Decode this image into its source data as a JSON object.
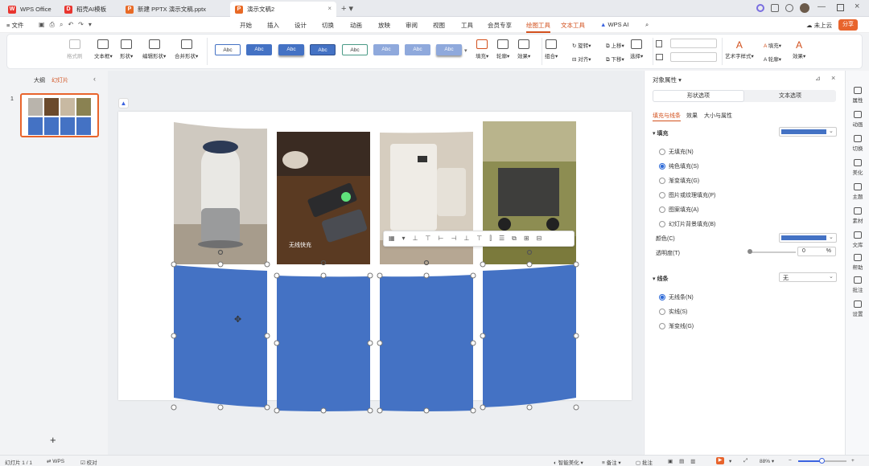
{
  "titlebar": {
    "tabs": [
      {
        "label": "WPS Office",
        "icon": "wps-logo-icon"
      },
      {
        "label": "稻壳AI模板",
        "icon": "docer-icon"
      },
      {
        "label": "新建 PPTX 演示文稿.pptx",
        "icon": "ppt-file-icon"
      },
      {
        "label": "演示文稿2",
        "icon": "ppt-file-icon"
      }
    ]
  },
  "menubar": {
    "file": "文件",
    "items": [
      "开始",
      "插入",
      "设计",
      "切换",
      "动画",
      "放映",
      "审阅",
      "视图",
      "工具",
      "会员专享",
      "绘图工具",
      "文本工具",
      "WPS AI"
    ],
    "active": "绘图工具",
    "cloud": "未上云",
    "share": "分享"
  },
  "ribbon": {
    "format_painter": "格式刷",
    "textbox": "文本框",
    "shape": "形状",
    "edit_shape": "编辑形状",
    "merge_shape": "合并形状",
    "style_tiles": [
      "Abc",
      "Abc",
      "Abc",
      "Abc",
      "Abc",
      "Abc",
      "Abc",
      "Abc"
    ],
    "fill": "填充",
    "outline": "轮廓",
    "effect": "效果",
    "group": "组合",
    "rotate": "旋转",
    "align": "对齐",
    "bring_up": "上移",
    "send_down": "下移",
    "select": "选择",
    "art_text": "艺术字样式",
    "text_fill": "填充",
    "text_outline": "轮廓",
    "text_effect": "效果"
  },
  "leftpanel": {
    "tab_outline": "大纲",
    "tab_slides": "幻灯片",
    "slide_number": "1"
  },
  "slide": {
    "photo_caption": "无线快充"
  },
  "rightpanel": {
    "title": "对象属性",
    "tab_shape": "形状选项",
    "tab_text": "文本选项",
    "subtabs": [
      "填充与线条",
      "效果",
      "大小与属性"
    ],
    "fill_section": "填充",
    "fill_options": [
      "无填充(N)",
      "纯色填充(S)",
      "渐变填充(G)",
      "图片或纹理填充(P)",
      "图案填充(A)",
      "幻灯片背景填充(B)"
    ],
    "fill_selected": 1,
    "color_label": "颜色(C)",
    "transparency_label": "透明度(T)",
    "transparency_value": "0",
    "transparency_unit": "%",
    "line_section": "线条",
    "line_value": "无",
    "line_options": [
      "无线条(N)",
      "实线(S)",
      "渐变线(G)"
    ],
    "line_selected": 0,
    "fill_color": "#4472c4"
  },
  "sidebar": {
    "items": [
      "属性",
      "动画",
      "切换",
      "美化",
      "主题",
      "素材",
      "文库",
      "帮助",
      "批注",
      "设置"
    ]
  },
  "statusbar": {
    "slide_info": "幻灯片 1 / 1",
    "wps": "WPS",
    "proofread": "校对",
    "smart": "智能美化",
    "notes": "备注",
    "comments": "批注",
    "zoom": "88%"
  },
  "accent_color": "#d2501d"
}
